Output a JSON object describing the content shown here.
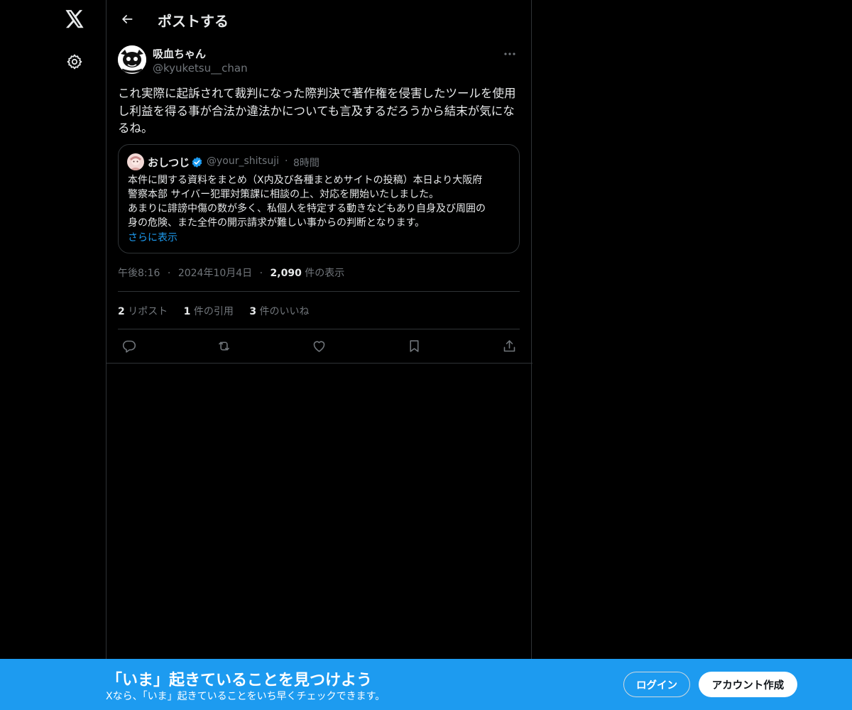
{
  "nav": {
    "logo_icon": "x-logo-icon",
    "settings_icon": "gear-icon"
  },
  "header": {
    "title": "ポストする",
    "back_icon": "arrow-left-icon"
  },
  "post": {
    "author_name": "吸血ちゃん",
    "author_handle": "@kyuketsu__chan",
    "text": "これ実際に起訴されて裁判になった際判決で著作権を侵害したツールを使用し利益を得る事が合法か違法かについても言及するだろうから結末が気になるね。",
    "quote": {
      "author_name": "おしつじ",
      "author_handle": "@your_shitsuji",
      "separator": "·",
      "time": "8時間",
      "lines": [
        "本件に関する資料をまとめ（X内及び各種まとめサイトの投稿）本日より大阪府",
        "警察本部 サイバー犯罪対策課に相談の上、対応を開始いたしました。",
        "あまりに誹謗中傷の数が多く、私個人を特定する動きなどもあり自身及び周囲の",
        "身の危険、また全件の開示請求が難しい事からの判断となります。"
      ],
      "show_more": "さらに表示"
    },
    "meta": {
      "time": "午後8:16",
      "dot1": "·",
      "date": "2024年10月4日",
      "dot2": "·",
      "views_count": "2,090",
      "views_label": "件の表示"
    },
    "stats": {
      "reposts_count": "2",
      "reposts_label": "リポスト",
      "quotes_count": "1",
      "quotes_label": "件の引用",
      "likes_count": "3",
      "likes_label": "件のいいね"
    },
    "actions": [
      "reply-icon",
      "repost-icon",
      "like-icon",
      "bookmark-icon",
      "share-icon"
    ]
  },
  "banner": {
    "title": "「いま」起きていることを見つけよう",
    "subtitle": "Xなら、「いま」起きていることをいち早くチェックできます。",
    "login_label": "ログイン",
    "signup_label": "アカウント作成"
  },
  "colors": {
    "background": "#000000",
    "border": "#2f3336",
    "text": "#e7e9ea",
    "muted": "#71767b",
    "accent": "#1d9bf0",
    "verified": "#1d9bf0"
  }
}
